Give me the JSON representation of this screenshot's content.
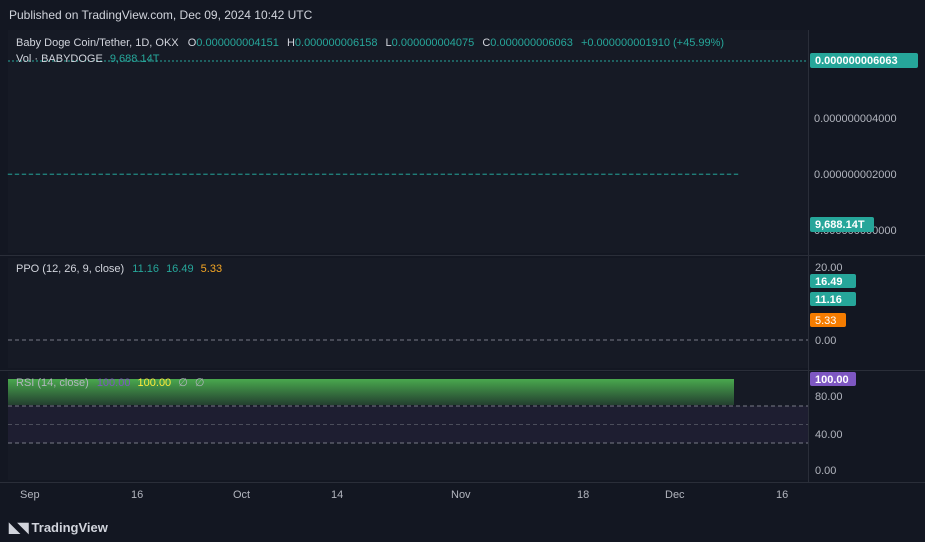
{
  "header": {
    "published": "Published on TradingView.com, Dec 09, 2024 10:42 UTC"
  },
  "symbol": {
    "title": "Baby Doge Coin/Tether, 1D, OKX",
    "o_label": "O",
    "o_value": "0.000000004151",
    "h_label": "H",
    "h_value": "0.000000006158",
    "l_label": "L",
    "l_value": "0.000000004075",
    "c_label": "C",
    "c_value": "0.000000006063",
    "change": "+0.000000001910 (+45.99%)",
    "vol_label": "Vol · BABYDOGE",
    "vol_value": "9,688.14T"
  },
  "ppo_legend": {
    "title": "PPO (12, 26, 9, close)",
    "v1": "11.16",
    "v2": "16.49",
    "v3": "5.33"
  },
  "rsi_legend": {
    "title": "RSI (14, close)",
    "v1": "100.00",
    "v2": "100.00",
    "v3": "∅",
    "v4": "∅"
  },
  "price_axis": {
    "ticks": [
      "0.000000004000",
      "0.000000002000",
      "0.000000000000"
    ],
    "last_price": "0.000000006063",
    "volume_tag": "9,688.14T"
  },
  "ppo_axis": {
    "ticks": [
      "20.00",
      "0.00"
    ],
    "tag_a": "16.49",
    "tag_b": "11.16",
    "tag_c": "5.33"
  },
  "rsi_axis": {
    "ticks": [
      "80.00",
      "40.00",
      "0.00"
    ],
    "tag": "100.00"
  },
  "time_axis": [
    "Sep",
    "16",
    "Oct",
    "14",
    "Nov",
    "18",
    "Dec",
    "16"
  ],
  "footer": {
    "brand": "TradingView"
  },
  "colors": {
    "up": "#26a69a",
    "down": "#ef5350",
    "ppo_line": "#26a69a",
    "ppo_signal": "#f5a623",
    "rsi": "#7e57c2",
    "accent": "#2962ff",
    "background": "#131722"
  },
  "chart_data": [
    {
      "type": "candlestick",
      "title": "Baby Doge Coin/Tether, 1D, OKX",
      "series": "price (USDT)",
      "ylim": [
        0.0,
        6.5e-09
      ],
      "last_close": 6.063e-09,
      "candles": [
        [
          1.9e-09,
          1.9e-09,
          1.9e-09,
          1.9e-09
        ],
        [
          1.9e-09,
          1.9e-09,
          1.9e-09,
          1.9e-09
        ],
        [
          1.9e-09,
          1.9e-09,
          1.9e-09,
          1.9e-09
        ],
        [
          1.9e-09,
          1.9e-09,
          1.9e-09,
          1.9e-09
        ],
        [
          1.9e-09,
          1.9e-09,
          1.9e-09,
          1.9e-09
        ],
        [
          1.9e-09,
          1.9e-09,
          1.9e-09,
          1.9e-09
        ],
        [
          1.9e-09,
          1.9e-09,
          1.9e-09,
          1.9e-09
        ],
        [
          1.9e-09,
          1.9e-09,
          1.9e-09,
          1.9e-09
        ],
        [
          1.9e-09,
          1.9e-09,
          1.9e-09,
          1.9e-09
        ],
        [
          1.9e-09,
          1.9e-09,
          1.9e-09,
          1.9e-09
        ],
        [
          1.9e-09,
          1.9e-09,
          1.9e-09,
          1.9e-09
        ],
        [
          1.9e-09,
          1.9e-09,
          1.9e-09,
          1.9e-09
        ],
        [
          1.9e-09,
          1.9e-09,
          1.9e-09,
          1.9e-09
        ],
        [
          1.9e-09,
          1.9e-09,
          1.9e-09,
          1.9e-09
        ],
        [
          1.9e-09,
          1.9e-09,
          1.9e-09,
          1.9e-09
        ],
        [
          1.9e-09,
          1.9e-09,
          1.9e-09,
          1.9e-09
        ],
        [
          1.9e-09,
          1.9e-09,
          1.9e-09,
          1.9e-09
        ],
        [
          1.9e-09,
          1.9e-09,
          1.9e-09,
          1.9e-09
        ],
        [
          1.9e-09,
          1.9e-09,
          1.9e-09,
          1.9e-09
        ],
        [
          1.9e-09,
          1.9e-09,
          1.9e-09,
          1.9e-09
        ],
        [
          1.9e-09,
          1.9e-09,
          1.9e-09,
          1.9e-09
        ],
        [
          1.9e-09,
          1.9e-09,
          1.9e-09,
          1.9e-09
        ],
        [
          1.9e-09,
          1.9e-09,
          1.9e-09,
          1.9e-09
        ],
        [
          1.9e-09,
          1.9e-09,
          1.9e-09,
          1.9e-09
        ],
        [
          1.9e-09,
          1.9e-09,
          1.9e-09,
          1.9e-09
        ],
        [
          1.9e-09,
          1.9e-09,
          1.9e-09,
          1.9e-09
        ],
        [
          1.9e-09,
          1.9e-09,
          1.9e-09,
          1.9e-09
        ],
        [
          1.9e-09,
          1.9e-09,
          1.9e-09,
          1.9e-09
        ],
        [
          1.9e-09,
          1.9e-09,
          1.9e-09,
          1.9e-09
        ],
        [
          1.9e-09,
          1.9e-09,
          1.9e-09,
          1.9e-09
        ],
        [
          1.9e-09,
          1.9e-09,
          1.9e-09,
          1.9e-09
        ],
        [
          1.9e-09,
          1.9e-09,
          1.9e-09,
          1.9e-09
        ],
        [
          1.9e-09,
          1.9e-09,
          1.9e-09,
          1.9e-09
        ],
        [
          1.9e-09,
          1.9e-09,
          1.9e-09,
          1.9e-09
        ],
        [
          1.9e-09,
          1.9e-09,
          1.9e-09,
          1.9e-09
        ],
        [
          1.9e-09,
          1.9e-09,
          1.9e-09,
          1.9e-09
        ],
        [
          1.9e-09,
          1.9e-09,
          1.9e-09,
          1.9e-09
        ],
        [
          1.9e-09,
          1.9e-09,
          1.9e-09,
          1.9e-09
        ],
        [
          1.9e-09,
          1.9e-09,
          1.9e-09,
          1.9e-09
        ],
        [
          1.9e-09,
          1.9e-09,
          1.9e-09,
          1.9e-09
        ],
        [
          1.9e-09,
          1.9e-09,
          1.9e-09,
          1.9e-09
        ],
        [
          1.9e-09,
          1.9e-09,
          1.9e-09,
          1.9e-09
        ],
        [
          1.9e-09,
          1.9e-09,
          1.9e-09,
          1.9e-09
        ],
        [
          1.9e-09,
          1.9e-09,
          1.9e-09,
          1.9e-09
        ],
        [
          1.9e-09,
          1.9e-09,
          1.9e-09,
          1.9e-09
        ],
        [
          1.9e-09,
          1.9e-09,
          1.9e-09,
          1.9e-09
        ],
        [
          1.9e-09,
          1.9e-09,
          1.9e-09,
          1.9e-09
        ],
        [
          1.9e-09,
          1.9e-09,
          1.9e-09,
          1.9e-09
        ],
        [
          1.9e-09,
          1.9e-09,
          1.9e-09,
          1.9e-09
        ],
        [
          1.9e-09,
          1.9e-09,
          1.9e-09,
          1.9e-09
        ],
        [
          1.9e-09,
          1.9e-09,
          1.9e-09,
          1.9e-09
        ],
        [
          1.9e-09,
          1.9e-09,
          1.9e-09,
          1.9e-09
        ],
        [
          1.9e-09,
          1.9e-09,
          1.9e-09,
          1.9e-09
        ],
        [
          1.9e-09,
          1.9e-09,
          1.9e-09,
          1.9e-09
        ],
        [
          1.9e-09,
          1.9e-09,
          1.9e-09,
          1.9e-09
        ],
        [
          1.9e-09,
          1.9e-09,
          1.9e-09,
          1.9e-09
        ],
        [
          1.9e-09,
          1.9e-09,
          1.9e-09,
          1.9e-09
        ],
        [
          1.9e-09,
          1.9e-09,
          1.9e-09,
          1.9e-09
        ],
        [
          1.9e-09,
          1.9e-09,
          1.9e-09,
          1.9e-09
        ],
        [
          1.9e-09,
          1.9e-09,
          1.9e-09,
          1.9e-09
        ],
        [
          1.9e-09,
          1.9e-09,
          1.9e-09,
          1.9e-09
        ],
        [
          1.9e-09,
          1.9e-09,
          1.9e-09,
          1.9e-09
        ],
        [
          1.9e-09,
          1.9e-09,
          1.9e-09,
          1.9e-09
        ],
        [
          1.9e-09,
          1.9e-09,
          1.9e-09,
          1.9e-09
        ],
        [
          1.9e-09,
          1.9e-09,
          1.9e-09,
          1.9e-09
        ],
        [
          1.9e-09,
          1.9e-09,
          1.9e-09,
          1.9e-09
        ],
        [
          1.9e-09,
          1.9e-09,
          1.9e-09,
          1.9e-09
        ],
        [
          1.9e-09,
          1.9e-09,
          1.9e-09,
          1.9e-09
        ],
        [
          1.9e-09,
          1.9e-09,
          1.9e-09,
          1.9e-09
        ],
        [
          1.9e-09,
          1.9e-09,
          1.9e-09,
          1.9e-09
        ],
        [
          1.9e-09,
          1.9e-09,
          1.9e-09,
          1.9e-09
        ],
        [
          1.9e-09,
          1.9e-09,
          1.9e-09,
          1.9e-09
        ],
        [
          1.9e-09,
          1.9e-09,
          1.9e-09,
          1.9e-09
        ],
        [
          1.9e-09,
          1.9e-09,
          1.9e-09,
          1.9e-09
        ],
        [
          1.9e-09,
          1.9e-09,
          1.9e-09,
          1.9e-09
        ],
        [
          1.9e-09,
          1.9e-09,
          1.9e-09,
          1.9e-09
        ],
        [
          1.9e-09,
          1.9e-09,
          1.9e-09,
          1.9e-09
        ],
        [
          1.9e-09,
          1.9e-09,
          1.9e-09,
          1.9e-09
        ],
        [
          1.9e-09,
          1.9e-09,
          1.9e-09,
          1.9e-09
        ],
        [
          1.9e-09,
          1.9e-09,
          1.9e-09,
          1.9e-09
        ],
        [
          1.9e-09,
          1.9e-09,
          1.9e-09,
          1.9e-09
        ],
        [
          1.9e-09,
          1.9e-09,
          1.9e-09,
          1.9e-09
        ],
        [
          1.9e-09,
          1.9e-09,
          1.9e-09,
          1.9e-09
        ],
        [
          1.9e-09,
          1.9e-09,
          1.9e-09,
          1.9e-09
        ],
        [
          1.9e-09,
          1.9e-09,
          1.9e-09,
          1.9e-09
        ],
        [
          1.9e-09,
          1.9e-09,
          1.9e-09,
          1.9e-09
        ],
        [
          1.9e-09,
          1.9e-09,
          1.9e-09,
          1.9e-09
        ],
        [
          1.9e-09,
          1.9e-09,
          1.9e-09,
          1.9e-09
        ],
        [
          1.9e-09,
          1.9e-09,
          1.9e-09,
          1.9e-09
        ],
        [
          1.9e-09,
          1.9e-09,
          1.9e-09,
          1.9e-09
        ],
        [
          1.9e-09,
          1.9e-09,
          1.9e-09,
          1.9e-09
        ],
        [
          1.9e-09,
          1.9e-09,
          1.9e-09,
          1.9e-09
        ],
        [
          1.9e-09,
          1.9e-09,
          1.9e-09,
          1.9e-09
        ],
        [
          1.9e-09,
          1.9e-09,
          1.9e-09,
          1.9e-09
        ],
        [
          1.9e-09,
          1.9e-09,
          1.9e-09,
          1.9e-09
        ],
        [
          1.9e-09,
          1.9e-09,
          1.9e-09,
          1.9e-09
        ],
        [
          1.9e-09,
          1.9e-09,
          1.9e-09,
          1.9e-09
        ],
        [
          1.9e-09,
          1.9e-09,
          1.9e-09,
          1.9e-09
        ],
        [
          1.9e-09,
          1.9e-09,
          1.9e-09,
          1.9e-09
        ],
        [
          1.9e-09,
          1.9e-09,
          1.9e-09,
          1.9e-09
        ],
        [
          1.9e-09,
          1.9e-09,
          1.9e-09,
          1.9e-09
        ],
        [
          1.9e-09,
          1.9e-09,
          1.9e-09,
          1.9e-09
        ],
        [
          1.9e-09,
          1.9e-09,
          1.9e-09,
          1.9e-09
        ],
        [
          1.9e-09,
          1.9e-09,
          1.9e-09,
          1.9e-09
        ],
        [
          1.9e-09,
          1.9e-09,
          1.9e-09,
          1.9e-09
        ]
      ],
      "volume": [],
      "volume_last": "9,688.14T"
    },
    {
      "type": "histogram+line",
      "title": "PPO (12, 26, 9, close)",
      "ylim": [
        -5,
        21
      ],
      "ppo": [],
      "signal": [],
      "hist": [],
      "last": {
        "line": 16.49,
        "hist": 11.16,
        "signal": 5.33
      }
    },
    {
      "type": "line",
      "title": "RSI (14, close)",
      "ylim": [
        0,
        100
      ],
      "bands": [
        30,
        50,
        70
      ],
      "rsi": [],
      "last": 100.0
    }
  ]
}
